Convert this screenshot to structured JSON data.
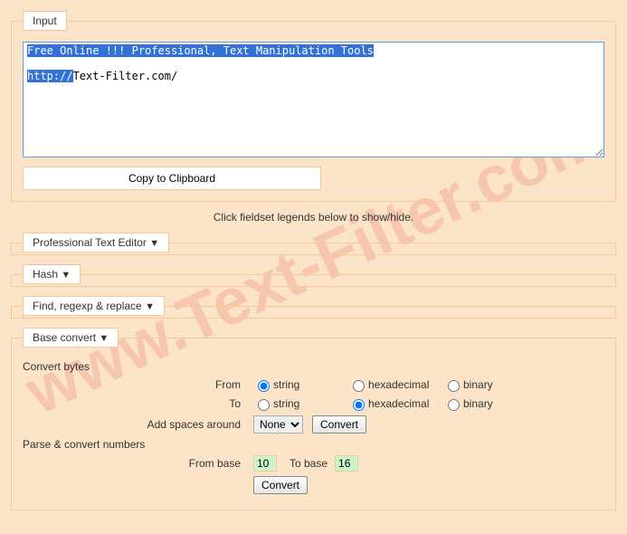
{
  "watermark": "www.Text-Filter.com",
  "input": {
    "legend": "Input",
    "line1_highlight": "Free Online !!! Professional, Text Manipulation Tools",
    "line2_highlight": "http://",
    "line2_rest": "Text-Filter.com/",
    "copy_button": "Copy to Clipboard"
  },
  "hint": "Click fieldset legends below to show/hide.",
  "sections": {
    "editor": "Professional Text Editor",
    "hash": "Hash",
    "find": "Find, regexp & replace",
    "base": "Base convert"
  },
  "triangle": "▼",
  "base": {
    "convert_bytes": "Convert bytes",
    "from": "From",
    "to": "To",
    "opt_string": "string",
    "opt_hex": "hexadecimal",
    "opt_binary": "binary",
    "add_spaces": "Add spaces around",
    "none": "None",
    "convert_btn": "Convert",
    "parse_numbers": "Parse & convert numbers",
    "from_base": "From base",
    "to_base": "To base",
    "from_base_val": "10",
    "to_base_val": "16"
  }
}
